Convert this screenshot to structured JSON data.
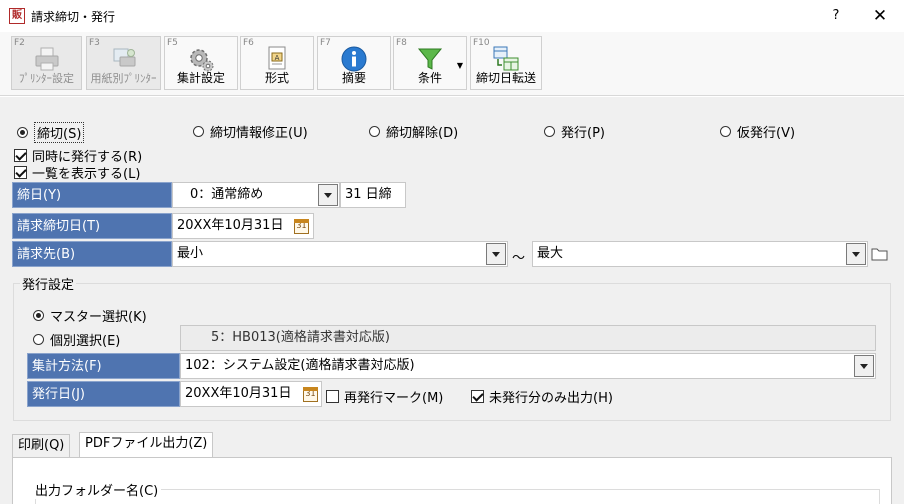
{
  "window": {
    "app_icon": "販",
    "title": "請求締切・発行",
    "help": "?",
    "close": "✕"
  },
  "toolbar": [
    {
      "key": "F2",
      "label": "ﾌﾟﾘﾝﾀｰ設定",
      "icon": "printer-icon",
      "disabled": true
    },
    {
      "key": "F3",
      "label": "用紙別ﾌﾟﾘﾝﾀｰ",
      "icon": "paper-printer-icon",
      "disabled": true
    },
    {
      "key": "F5",
      "label": "集計設定",
      "icon": "gear-icon",
      "disabled": false
    },
    {
      "key": "F6",
      "label": "形式",
      "icon": "format-icon",
      "disabled": false
    },
    {
      "key": "F7",
      "label": "摘要",
      "icon": "info-icon",
      "disabled": false
    },
    {
      "key": "F8",
      "label": "条件",
      "icon": "filter-icon",
      "disabled": false
    },
    {
      "key": "F10",
      "label": "締切日転送",
      "icon": "transfer-icon",
      "disabled": false
    }
  ],
  "modes": [
    {
      "label": "締切(S)",
      "selected": true
    },
    {
      "label": "締切情報修正(U)",
      "selected": false
    },
    {
      "label": "締切解除(D)",
      "selected": false
    },
    {
      "label": "発行(P)",
      "selected": false
    },
    {
      "label": "仮発行(V)",
      "selected": false
    }
  ],
  "options": {
    "issue_simultaneously": {
      "label": "同時に発行する(R)",
      "checked": true
    },
    "show_list": {
      "label": "一覧を表示する(L)",
      "checked": true
    }
  },
  "form": {
    "closing_day": {
      "label": "締日(Y)",
      "value": "　0：通常締め",
      "suffix": "31 日締"
    },
    "closing_date": {
      "label": "請求締切日(T)",
      "value": "20XX年10月31日"
    },
    "billing_to": {
      "label": "請求先(B)",
      "from": "最小",
      "separator": "～",
      "to": "最大"
    }
  },
  "issue_settings": {
    "title": "発行設定",
    "master_select": {
      "label": "マスター選択(K)",
      "selected": true
    },
    "individual_select": {
      "label": "個別選択(E)",
      "selected": false,
      "value": "　　5：HB013(適格請求書対応版)"
    },
    "aggregation": {
      "label": "集計方法(F)",
      "value": "102：システム設定(適格請求書対応版)"
    },
    "issue_date": {
      "label": "発行日(J)",
      "value": "20XX年10月31日"
    },
    "reissue_mark": {
      "label": "再発行マーク(M)",
      "checked": false
    },
    "unissued_only": {
      "label": "未発行分のみ出力(H)",
      "checked": true
    }
  },
  "tabs": [
    {
      "label": "印刷(Q)",
      "active": false
    },
    {
      "label": "PDFファイル出力(Z)",
      "active": true
    }
  ],
  "pdf_output": {
    "folder_label": "出力フォルダー名(C)"
  }
}
